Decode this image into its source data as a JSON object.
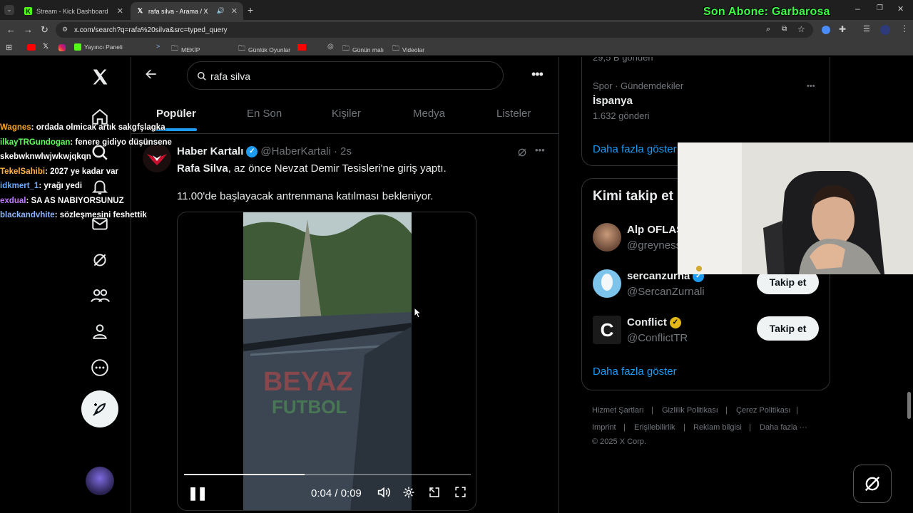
{
  "browser": {
    "tabs": [
      {
        "title": "Stream - Kick Dashboard",
        "icon": "kick-icon",
        "active": false
      },
      {
        "title": "rafa silva - Arama / X",
        "icon": "x-icon",
        "active": true
      }
    ],
    "url": "x.com/search?q=rafa%20silva&src=typed_query",
    "bookmarks": [
      {
        "label": "Yayıncı Paneli"
      },
      {
        "label": "MEKİP"
      },
      {
        "label": "Günlük Oyunlar"
      },
      {
        "label": "Günün malı"
      },
      {
        "label": "Videolar"
      }
    ]
  },
  "overlay": {
    "sub_text": "Son Abone: Garbarosa"
  },
  "search": {
    "query": "rafa silva"
  },
  "tabs": [
    "Popüler",
    "En Son",
    "Kişiler",
    "Medya",
    "Listeler"
  ],
  "tweet": {
    "author": "Haber Kartalı",
    "handle": "@HaberKartali",
    "time": "· 2s",
    "line1_bold": "Rafa Silva",
    "line1_rest": ", az önce Nevzat Demir Tesisleri'ne giriş yaptı.",
    "line2": "11.00'de başlayacak antrenmana katılması bekleniyor.",
    "video": {
      "time": "0:04 / 0:09",
      "progress": 0.42,
      "watermark_top": "BEYAZ",
      "watermark_bottom": "FUTBOL"
    }
  },
  "right": {
    "trend_partial": "29,5 B gönderi",
    "trend_category": "Spor · Gündemdekiler",
    "trend_name": "İspanya",
    "trend_count": "1.632 gönderi",
    "show_more": "Daha fazla göster",
    "who_to_follow": "Kimi takip et",
    "follow": [
      {
        "name": "Alp OFLAS",
        "handle": "@greyness",
        "verified": "none"
      },
      {
        "name": "sercanzurna",
        "handle": "@SercanZurnali",
        "verified": "blue",
        "button": "Takip et"
      },
      {
        "name": "Conflict",
        "handle": "@ConflictTR",
        "verified": "gold",
        "button": "Takip et"
      }
    ],
    "show_more_2": "Daha fazla göster",
    "footer": [
      "Hizmet Şartları",
      "Gizlilik Politikası",
      "Çerez Politikası",
      "Imprint",
      "Erişilebilirlik",
      "Reklam bilgisi",
      "Daha fazla ···"
    ],
    "copyright": "© 2025 X Corp."
  },
  "chat": [
    {
      "user": "Wagnes",
      "color": "#f5a623",
      "msg": ": ordada olmicak artık sakgfşlagka"
    },
    {
      "user": "ilkayTRGundogan",
      "color": "#5cff5c",
      "msg": ": fenere gidiyo düşünsene"
    },
    {
      "user": "",
      "color": "#ffffff",
      "msg": "skebwknwlwjwkwjqkqn"
    },
    {
      "user": "TekelSahibi",
      "color": "#ffb347",
      "msg": ": 2027 ye kadar var"
    },
    {
      "user": "idkmert_1",
      "color": "#6ba8ff",
      "msg": ": yrağı yedi"
    },
    {
      "user": "exdual",
      "color": "#c47bff",
      "msg": ": SA AS NABIYORSUNUZ"
    },
    {
      "user": "blackandvhite",
      "color": "#8ab4ff",
      "msg": ": sözleşmesini feshettik"
    }
  ]
}
